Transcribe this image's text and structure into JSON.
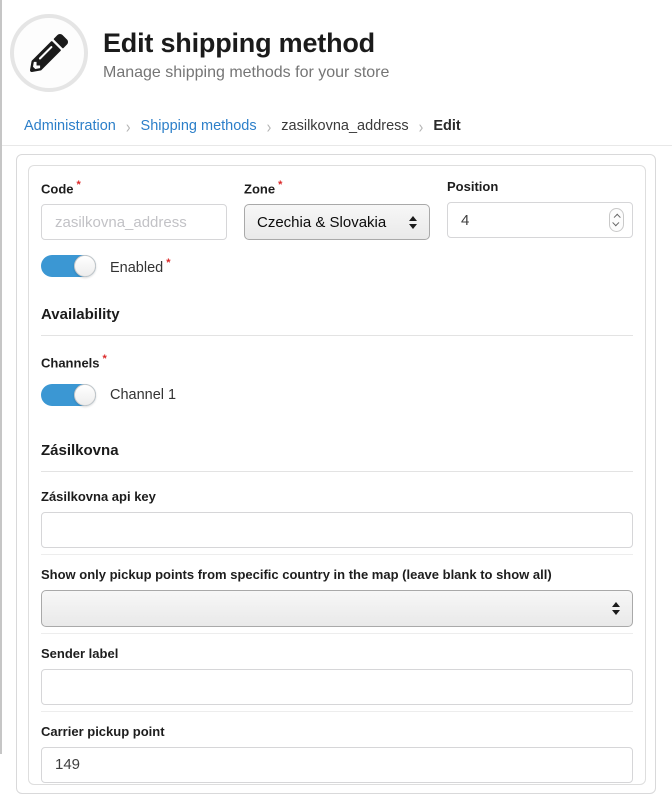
{
  "header": {
    "title": "Edit shipping method",
    "subtitle": "Manage shipping methods for your store",
    "icon": "pencil-icon"
  },
  "breadcrumb": {
    "items": [
      {
        "label": "Administration",
        "type": "link"
      },
      {
        "label": "Shipping methods",
        "type": "link"
      },
      {
        "label": "zasilkovna_address",
        "type": "text"
      },
      {
        "label": "Edit",
        "type": "active"
      }
    ],
    "separator": "›"
  },
  "form": {
    "required_marker": "*",
    "code": {
      "label": "Code",
      "required": true,
      "value": "",
      "placeholder": "zasilkovna_address"
    },
    "zone": {
      "label": "Zone",
      "required": true,
      "selected": "Czechia & Slovakia"
    },
    "position": {
      "label": "Position",
      "required": false,
      "value": "4"
    },
    "enabled": {
      "label": "Enabled",
      "required": true,
      "state": "on"
    },
    "availability": {
      "heading": "Availability",
      "channels_label": "Channels",
      "channels_required": true,
      "channel_toggle": {
        "label": "Channel 1",
        "state": "on"
      }
    },
    "zasilkovna": {
      "heading": "Zásilkovna",
      "api_key": {
        "label": "Zásilkovna api key",
        "value": ""
      },
      "country_filter": {
        "label": "Show only pickup points from specific country in the map (leave blank to show all)",
        "selected": ""
      },
      "sender_label": {
        "label": "Sender label",
        "value": ""
      },
      "carrier_pickup_point": {
        "label": "Carrier pickup point",
        "value": "149"
      }
    }
  },
  "colors": {
    "link_blue": "#2c7fc9",
    "toggle_blue": "#3b97d3",
    "required_red": "#db2828",
    "card_border": "#d9d9da",
    "title_text": "#1b1b1b",
    "subtitle_text": "#757575"
  }
}
